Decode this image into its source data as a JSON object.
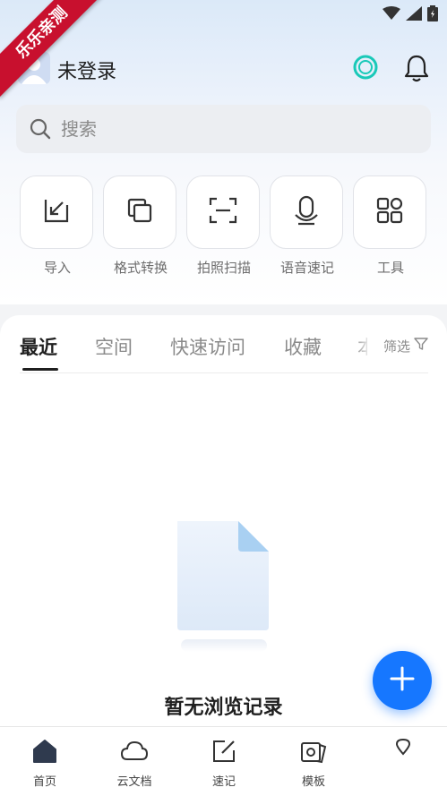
{
  "status_bar": {
    "icons": [
      "wifi-icon",
      "signal-icon",
      "battery-icon"
    ]
  },
  "ribbon": {
    "text": "乐乐亲测"
  },
  "header": {
    "login_label": "未登录",
    "icons": [
      "avatar",
      "cloud-sync-icon",
      "bell-icon"
    ]
  },
  "search": {
    "placeholder": "搜索"
  },
  "shortcuts": [
    {
      "label": "导入",
      "icon": "import-icon"
    },
    {
      "label": "格式转换",
      "icon": "format-convert-icon"
    },
    {
      "label": "拍照扫描",
      "icon": "scan-icon"
    },
    {
      "label": "语音速记",
      "icon": "microphone-icon"
    },
    {
      "label": "工具",
      "icon": "tools-grid-icon"
    }
  ],
  "tabs": [
    {
      "label": "最近",
      "active": true
    },
    {
      "label": "空间",
      "active": false
    },
    {
      "label": "快速访问",
      "active": false
    },
    {
      "label": "收藏",
      "active": false
    },
    {
      "label": "本",
      "active": false
    }
  ],
  "filter": {
    "label": "筛选",
    "icon": "filter-icon"
  },
  "empty_state": {
    "text": "暂无浏览记录",
    "icon": "empty-document-icon"
  },
  "fab": {
    "icon": "plus-icon"
  },
  "bottom_nav": [
    {
      "label": "首页",
      "icon": "home-icon",
      "active": true
    },
    {
      "label": "云文档",
      "icon": "cloud-icon",
      "active": false
    },
    {
      "label": "速记",
      "icon": "edit-icon",
      "active": false
    },
    {
      "label": "模板",
      "icon": "template-icon",
      "active": false
    },
    {
      "label": "",
      "icon": "location-icon",
      "active": false
    }
  ],
  "colors": {
    "accent": "#1677ff",
    "ribbon": "#c8102e",
    "cloud_icon": "#19c9b8"
  }
}
